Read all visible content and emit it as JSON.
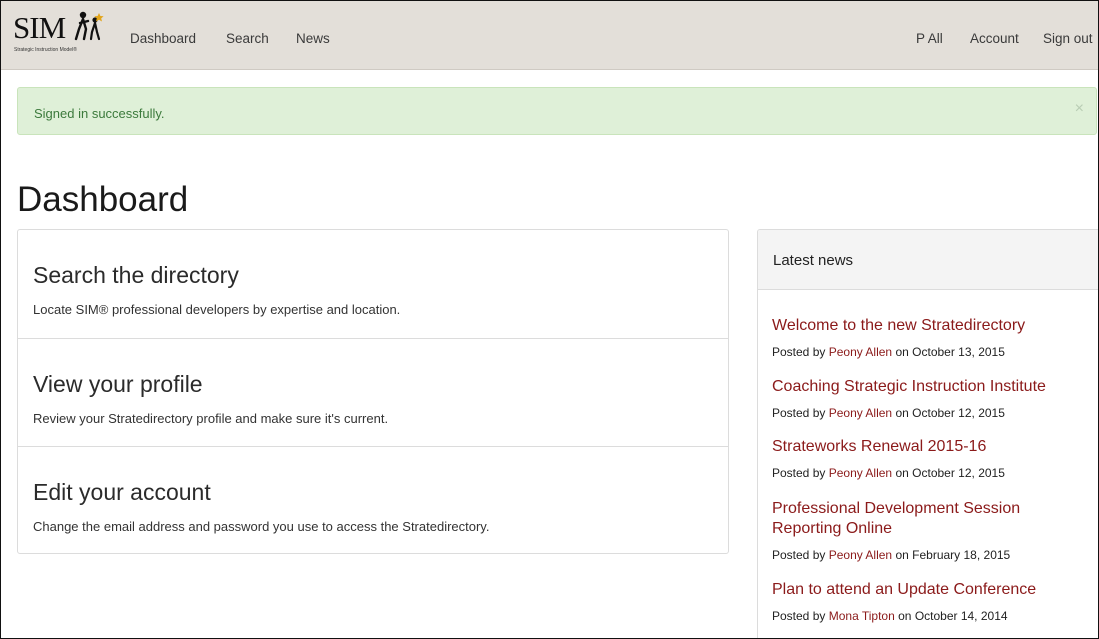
{
  "brand": {
    "logo_text": "SIM",
    "logo_subtext": "Strategic Instruction Model®"
  },
  "nav": {
    "left": [
      "Dashboard",
      "Search",
      "News"
    ],
    "right": [
      "P All",
      "Account",
      "Sign out"
    ]
  },
  "alert": {
    "message": "Signed in successfully.",
    "close": "×"
  },
  "page": {
    "title": "Dashboard"
  },
  "cards": [
    {
      "heading": "Search the directory",
      "description": "Locate SIM® professional developers by expertise and location."
    },
    {
      "heading": "View your profile",
      "description": "Review your Stratedirectory profile and make sure it's current."
    },
    {
      "heading": "Edit your account",
      "description": "Change the email address and password you use to access the Stratedirectory."
    }
  ],
  "news": {
    "header": "Latest news",
    "posted_by": "Posted by",
    "on": "on",
    "items": [
      {
        "title": "Welcome to the new Stratedirectory",
        "author": "Peony Allen",
        "date": "October 13, 2015"
      },
      {
        "title": "Coaching Strategic Instruction Institute",
        "author": "Peony Allen",
        "date": "October 12, 2015"
      },
      {
        "title": "Strateworks Renewal 2015-16",
        "author": "Peony Allen",
        "date": "October 12, 2015"
      },
      {
        "title": "Professional Development Session Reporting Online",
        "author": "Peony Allen",
        "date": "February 18, 2015"
      },
      {
        "title": "Plan to attend an Update Conference",
        "author": "Mona Tipton",
        "date": "October 14, 2014"
      }
    ]
  },
  "colors": {
    "navbar_bg": "#e3dfd9",
    "alert_bg": "#dff0d8",
    "alert_text": "#3c7a3c",
    "link_accent": "#8b1a1a"
  }
}
